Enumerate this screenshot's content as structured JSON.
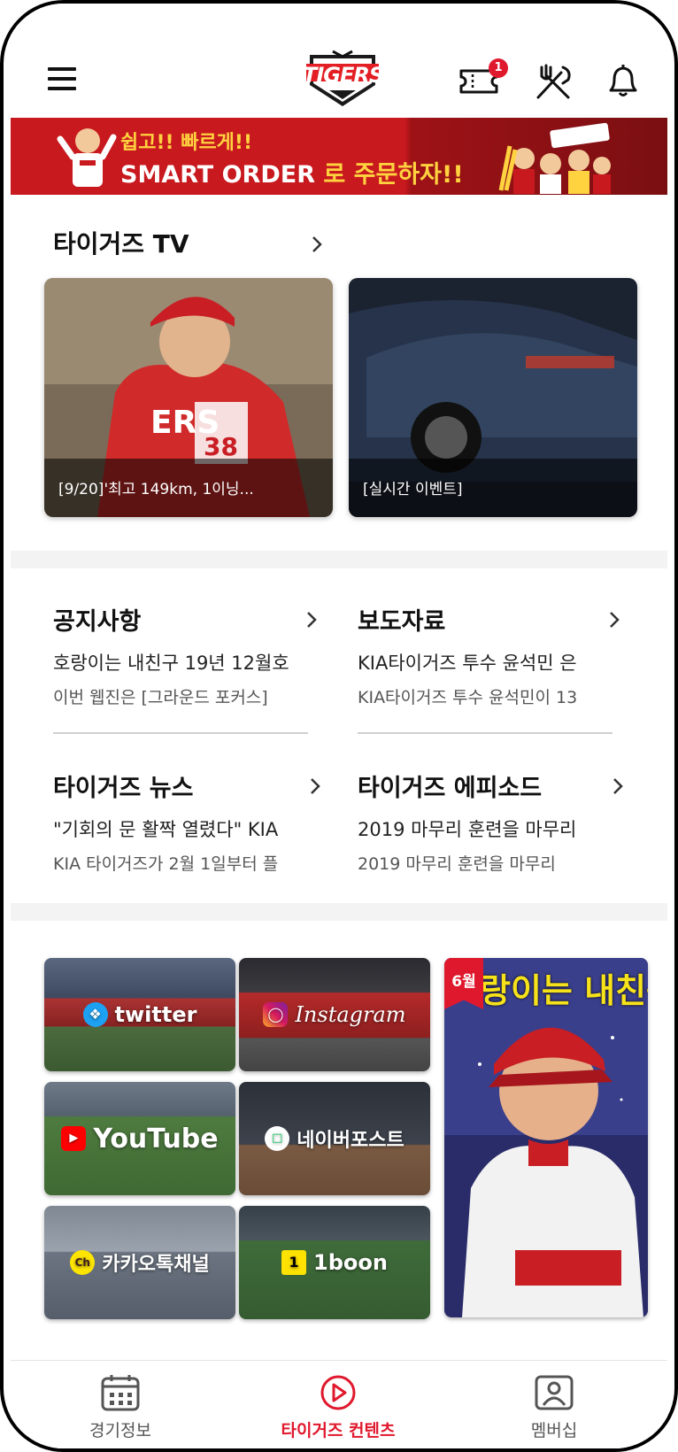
{
  "header": {
    "logo_text": "TIGERS",
    "ticket_badge": "1"
  },
  "banner": {
    "line1": "쉽고!! 빠르게!!",
    "line2_main": "SMART ORDER",
    "line2_accent": " 로 주문하자!!"
  },
  "tigers_tv": {
    "title": "타이거즈 TV",
    "videos": [
      {
        "caption": "[9/20]'최고 149km, 1이닝..."
      },
      {
        "caption": "[실시간 이벤트]"
      }
    ]
  },
  "news": [
    {
      "title": "공지사항",
      "headline": "호랑이는 내친구 19년 12월호",
      "summary": "이번 웹진은 [그라운드 포커스]"
    },
    {
      "title": "보도자료",
      "headline": "KIA타이거즈 투수 윤석민 은",
      "summary": "KIA타이거즈 투수 윤석민이 13"
    },
    {
      "title": "타이거즈 뉴스",
      "headline": "\"기회의 문 활짝 열렸다\" KIA",
      "summary": "KIA 타이거즈가 2월 1일부터 플"
    },
    {
      "title": "타이거즈 에피소드",
      "headline": "2019 마무리 훈련을 마무리",
      "summary": "2019 마무리 훈련을 마무리"
    }
  ],
  "social": {
    "twitter": "twitter",
    "instagram": "Instagram",
    "youtube": "YouTube",
    "naver_post": "네이버포스트",
    "kakao_channel": "카카오톡채널",
    "kakao_ch_icon": "Ch",
    "oneboon": "1boon",
    "oneboon_icon": "1"
  },
  "magazine": {
    "month": "6월",
    "title": "랑이는 내친구 다"
  },
  "bottom_nav": {
    "items": [
      {
        "label": "경기정보",
        "icon": "calendar-icon"
      },
      {
        "label": "타이거즈 컨텐츠",
        "icon": "play-icon",
        "active": true
      },
      {
        "label": "멤버십",
        "icon": "profile-card-icon"
      }
    ]
  },
  "colors": {
    "brand_red": "#e0182d",
    "banner_red": "#c8191e",
    "accent_yellow": "#ffd23f"
  }
}
